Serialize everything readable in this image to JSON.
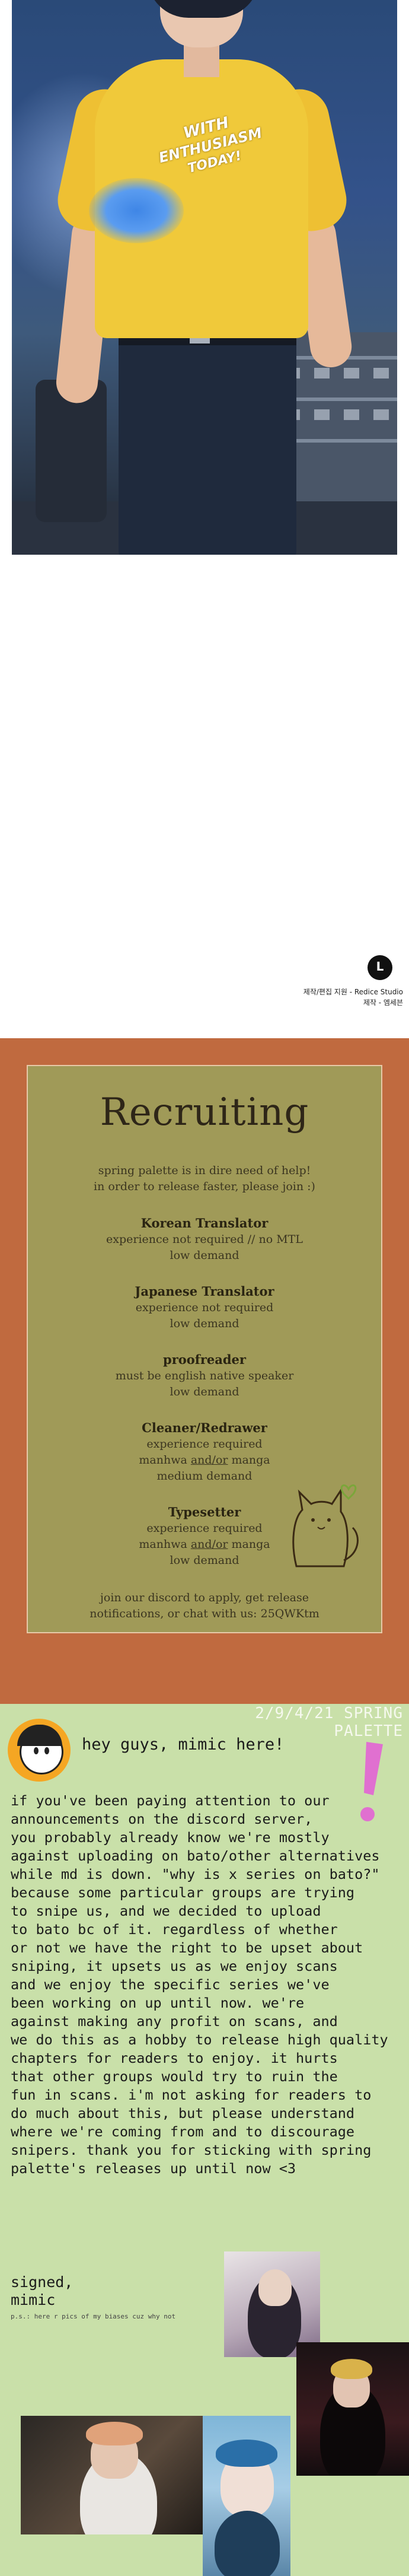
{
  "comic": {
    "shirt_text": [
      "WITH",
      "ENTHUSIASM",
      "TODAY!"
    ]
  },
  "credits": {
    "logo_letter": "L",
    "line1": "제작/편집 지원 - Redice Studio",
    "line2": "제작 - 엠세븐"
  },
  "recruiting": {
    "title": "Recruiting",
    "intro": [
      "spring palette is in dire need of help!",
      "in order to release faster, please join :)"
    ],
    "roles": [
      {
        "title": "Korean Translator",
        "lines": [
          "experience not required // no MTL",
          "low demand"
        ]
      },
      {
        "title": "Japanese Translator",
        "lines": [
          "experience not required",
          "low demand"
        ]
      },
      {
        "title": "proofreader",
        "lines": [
          "must be english native speaker",
          "low demand"
        ]
      },
      {
        "title": "Cleaner/Redrawer",
        "lines": [
          "experience required"
        ],
        "mm_prefix": "manhwa ",
        "mm_and": "and/or",
        "mm_suffix": " manga",
        "last": "medium demand"
      },
      {
        "title": "Typesetter",
        "lines": [
          "experience required"
        ],
        "mm_prefix": "manhwa ",
        "mm_and": "and/or",
        "mm_suffix": " manga",
        "last": "low demand"
      }
    ],
    "footer": [
      "join our discord to apply, get release",
      "notifications, or chat with us: 25QWKtm"
    ]
  },
  "note": {
    "date_banner": "2/9/4/21 SPRING PALETTE",
    "greeting": "hey guys, mimic here!",
    "body": "if you've been paying attention to our\nannouncements on the discord server,\nyou probably already know we're mostly\nagainst uploading on bato/other alternatives\nwhile md is down. \"why is x series on bato?\"\nbecause some particular groups are trying\nto snipe us, and we decided to upload\nto bato bc of it. regardless of whether\nor not we have the right to be upset about\nsniping, it upsets us as we enjoy scans\nand we enjoy the specific series we've\nbeen working on up until now. we're\nagainst making any profit on scans, and\nwe do this as a hobby to release high quality\nchapters for readers to enjoy. it hurts\nthat other groups would try to ruin the\nfun in scans. i'm not asking for readers to\ndo much about this, but please understand\nwhere we're coming from and to discourage\nsnipers. thank you for sticking with spring\npalette's releases up until now <3",
    "signed": "signed,\nmimic",
    "ps": "p.s.: here r pics of my biases cuz why not"
  },
  "colors": {
    "recruit_bg": "#c06a3f",
    "card_bg": "#a09a58",
    "note_bg": "#c9e0a9",
    "accent_pink": "#e070d0"
  }
}
